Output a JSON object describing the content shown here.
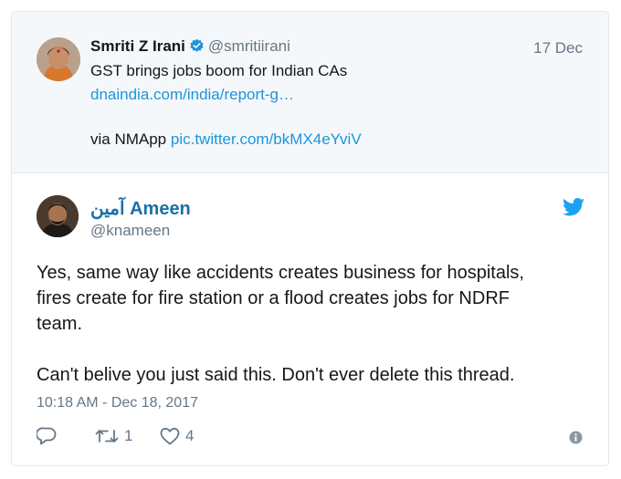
{
  "quoted_tweet": {
    "name": "Smriti Z Irani",
    "handle": "@smritiirani",
    "date": "17 Dec",
    "text": "GST brings jobs boom for Indian CAs",
    "link": "dnaindia.com/india/report-g…",
    "via_prefix": "via NMApp ",
    "via_link": "pic.twitter.com/bkMX4eYviV"
  },
  "reply_tweet": {
    "name": "آمین Ameen",
    "handle": "@knameen",
    "text_lines": [
      "Yes, same way like accidents creates business for hospitals,",
      "fires create for fire station or a flood creates jobs for NDRF",
      "team."
    ],
    "text_line2": "Can't belive you just said this. Don't ever delete this thread.",
    "timestamp": "10:18 AM - Dec 18, 2017",
    "retweet_count": "1",
    "like_count": "4"
  },
  "icons": {
    "verified": "verified-badge-icon",
    "bird": "twitter-bird-icon",
    "reply": "reply-icon",
    "retweet": "retweet-icon",
    "like": "heart-icon",
    "info": "info-icon"
  },
  "colors": {
    "accent": "#1b95e0",
    "muted": "#657786",
    "quoted_bg": "#f5f8fa",
    "heart": "#657786"
  }
}
